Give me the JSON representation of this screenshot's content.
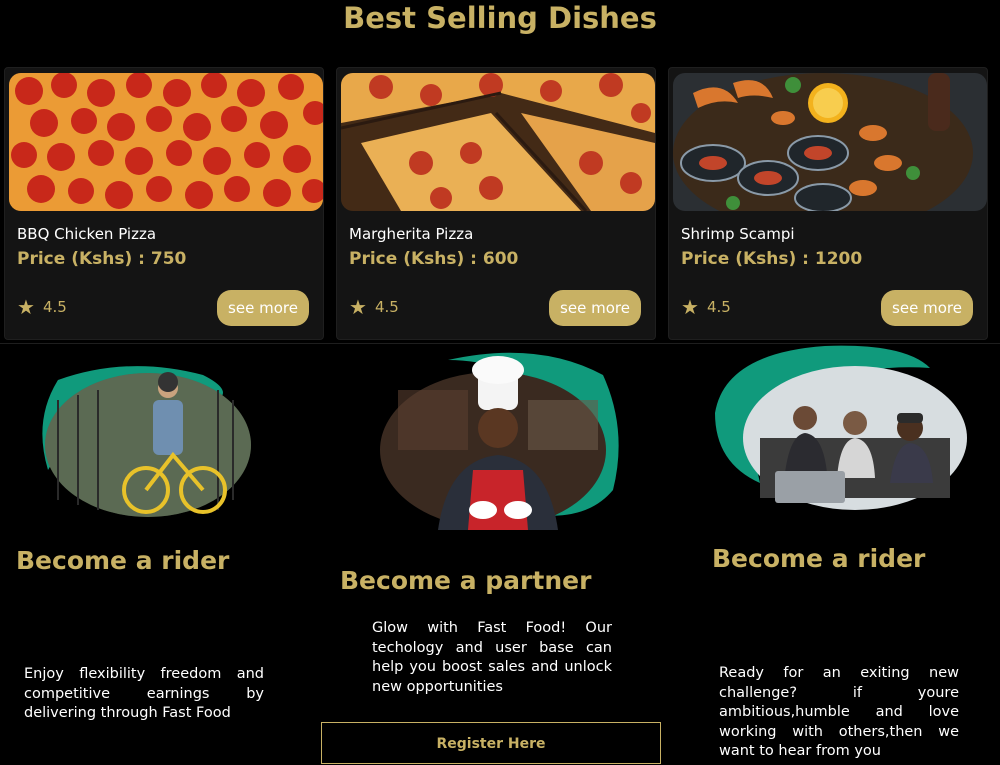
{
  "section_title": "Best Selling Dishes",
  "dishes": [
    {
      "name": "BBQ Chicken Pizza",
      "price": "Price (Kshs) : 750",
      "rating": "4.5",
      "button": "see more",
      "image": "pepperoni-pizza-photo"
    },
    {
      "name": "Margherita Pizza",
      "price": "Price (Kshs) : 600",
      "rating": "4.5",
      "button": "see more",
      "image": "sliced-pizza-photo"
    },
    {
      "name": "Shrimp Scampi",
      "price": "Price (Kshs) : 1200",
      "rating": "4.5",
      "button": "see more",
      "image": "seafood-platter-photo"
    }
  ],
  "promos": [
    {
      "heading": "Become a rider",
      "text": "Enjoy flexibility freedom and competitive earnings by delivering through Fast Food",
      "image": "cyclist-photo"
    },
    {
      "heading": "Become a partner",
      "text": "Glow with Fast Food! Our techology and user base can help you boost sales and unlock new opportunities",
      "button": "Register Here",
      "image": "chef-photo"
    },
    {
      "heading": "Become a rider",
      "text": "Ready for an exiting new challenge? if youre ambitious,humble and love working with others,then we want to hear from you",
      "image": "team-meeting-photo"
    }
  ],
  "colors": {
    "accent": "#c8b164",
    "background": "#000000",
    "card": "#141414",
    "blob": "#109a7c"
  },
  "icons": {
    "rating": "star-icon"
  }
}
